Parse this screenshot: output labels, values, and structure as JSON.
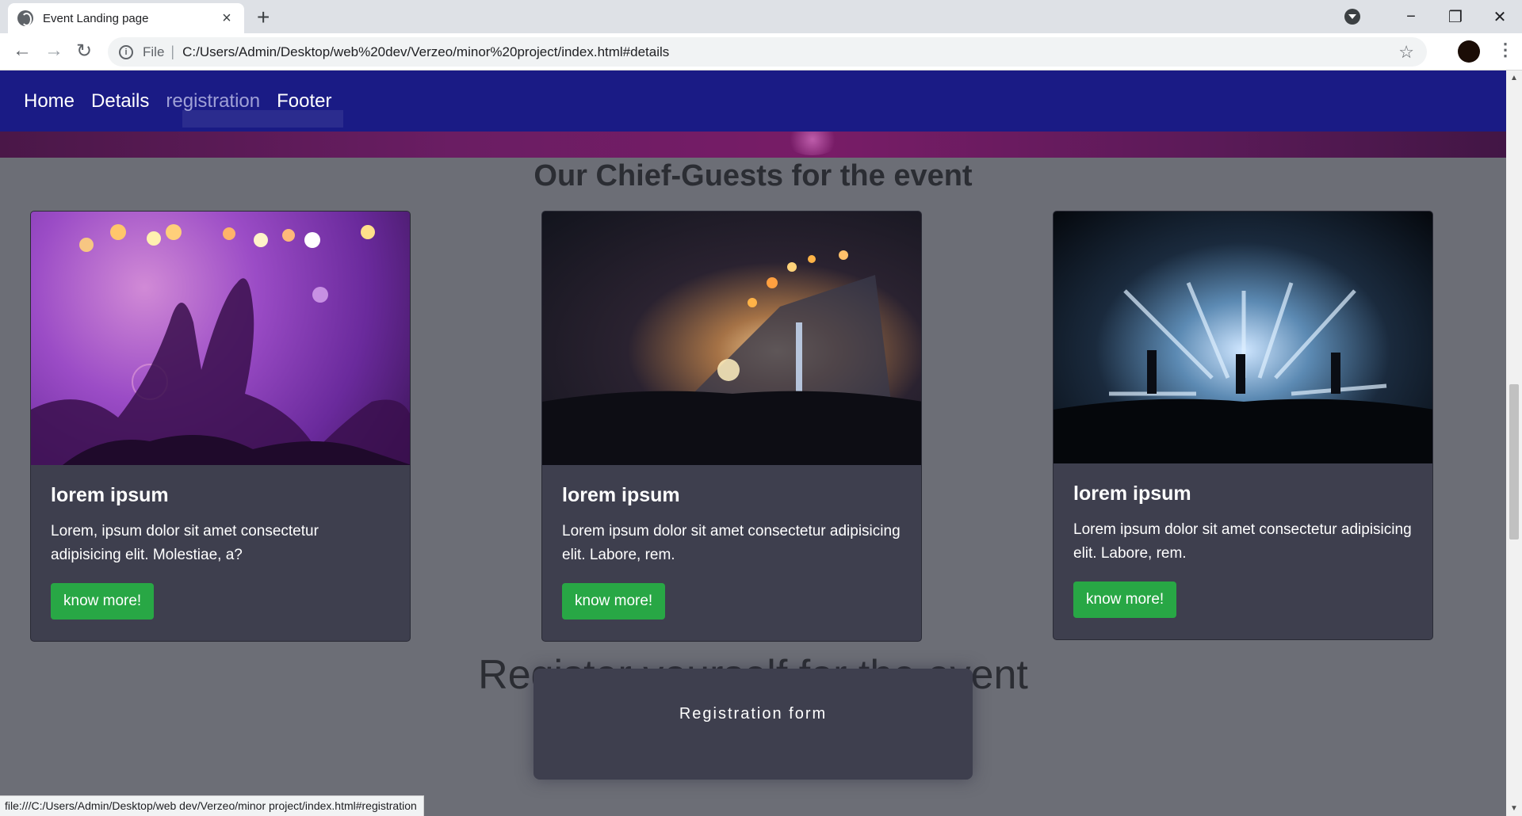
{
  "browser": {
    "tab_title": "Event Landing page",
    "url_scheme_label": "File",
    "url": "C:/Users/Admin/Desktop/web%20dev/Verzeo/minor%20project/index.html#details",
    "status_url": "file:///C:/Users/Admin/Desktop/web dev/Verzeo/minor project/index.html#registration"
  },
  "site_nav": {
    "items": [
      "Home",
      "Details",
      "registration",
      "Footer"
    ]
  },
  "guests": {
    "heading": "Our Chief-Guests for the event",
    "cards": [
      {
        "title": "lorem ipsum",
        "text": "Lorem, ipsum dolor sit amet consectetur adipisicing elit. Molestiae, a?",
        "button": "know more!"
      },
      {
        "title": "lorem ipsum",
        "text": "Lorem ipsum dolor sit amet consectetur adipisicing elit. Labore, rem.",
        "button": "know more!"
      },
      {
        "title": "lorem ipsum",
        "text": "Lorem ipsum dolor sit amet consectetur adipisicing elit. Labore, rem.",
        "button": "know more!"
      }
    ]
  },
  "registration": {
    "heading": "Register yourself for the event",
    "form_title": "Registration form"
  },
  "colors": {
    "nav_bg": "#1a1b85",
    "page_bg": "#6c6e76",
    "card_bg": "#3e3f4e",
    "button_bg": "#28a745"
  }
}
